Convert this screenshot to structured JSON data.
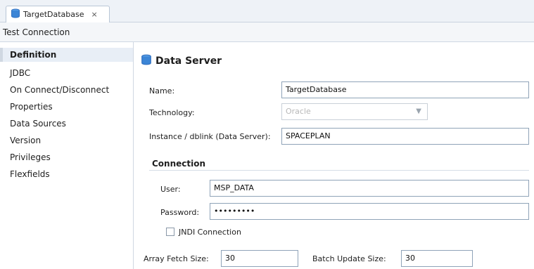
{
  "tab": {
    "title": "TargetDatabase",
    "close_glyph": "×",
    "icon": "database-icon"
  },
  "toolbar": {
    "test_connection": "Test Connection"
  },
  "nav": {
    "items": [
      {
        "label": "Definition",
        "active": true
      },
      {
        "label": "JDBC"
      },
      {
        "label": "On Connect/Disconnect"
      },
      {
        "label": "Properties"
      },
      {
        "label": "Data Sources"
      },
      {
        "label": "Version"
      },
      {
        "label": "Privileges"
      },
      {
        "label": "Flexfields"
      }
    ]
  },
  "section": {
    "title": "Data Server",
    "icon": "database-icon"
  },
  "form": {
    "name_label": "Name:",
    "name_value": "TargetDatabase",
    "technology_label": "Technology:",
    "technology_value": "Oracle",
    "instance_label": "Instance / dblink (Data Server):",
    "instance_value": "SPACEPLAN",
    "connection_title": "Connection",
    "user_label": "User:",
    "user_value": "MSP_DATA",
    "password_label": "Password:",
    "password_value": "•••••••••",
    "jndi_label": "JNDI Connection",
    "array_fetch_label": "Array Fetch Size:",
    "array_fetch_value": "30",
    "batch_update_label": "Batch Update Size:",
    "batch_update_value": "30"
  },
  "colors": {
    "accent": "#2f6fc0",
    "border": "#8fa3b8"
  }
}
